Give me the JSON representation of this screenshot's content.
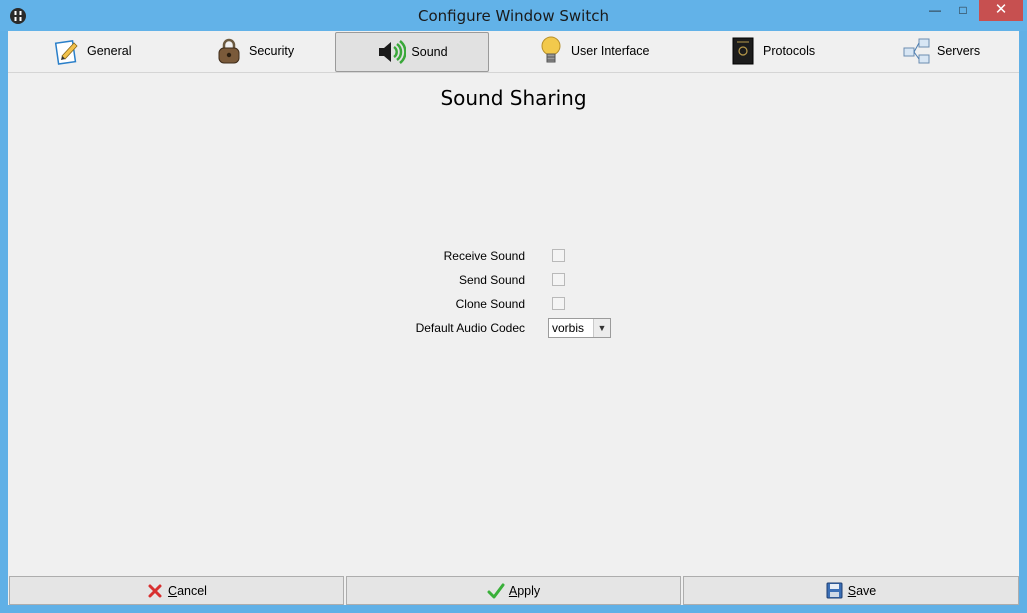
{
  "window": {
    "title": "Configure Window Switch",
    "minimize_glyph": "—",
    "maximize_glyph": "□",
    "close_glyph": "✕"
  },
  "tabs": [
    {
      "label": "General",
      "icon": "edit-doc-icon"
    },
    {
      "label": "Security",
      "icon": "padlock-icon"
    },
    {
      "label": "Sound",
      "icon": "speaker-icon",
      "active": true
    },
    {
      "label": "User Interface",
      "icon": "lightbulb-icon"
    },
    {
      "label": "Protocols",
      "icon": "passport-icon"
    },
    {
      "label": "Servers",
      "icon": "network-icon"
    }
  ],
  "main": {
    "heading": "Sound Sharing",
    "receive_sound_label": "Receive Sound",
    "send_sound_label": "Send Sound",
    "clone_sound_label": "Clone Sound",
    "codec_label": "Default Audio Codec",
    "codec_value": "vorbis",
    "receive_sound_checked": false,
    "send_sound_checked": false,
    "clone_sound_checked": false
  },
  "buttons": {
    "cancel_mnemonic": "C",
    "cancel_rest": "ancel",
    "apply_mnemonic": "A",
    "apply_rest": "pply",
    "save_mnemonic": "S",
    "save_rest": "ave"
  },
  "colors": {
    "titlebar": "#62b2e8",
    "close": "#c75050",
    "panel": "#f0f0f0"
  }
}
